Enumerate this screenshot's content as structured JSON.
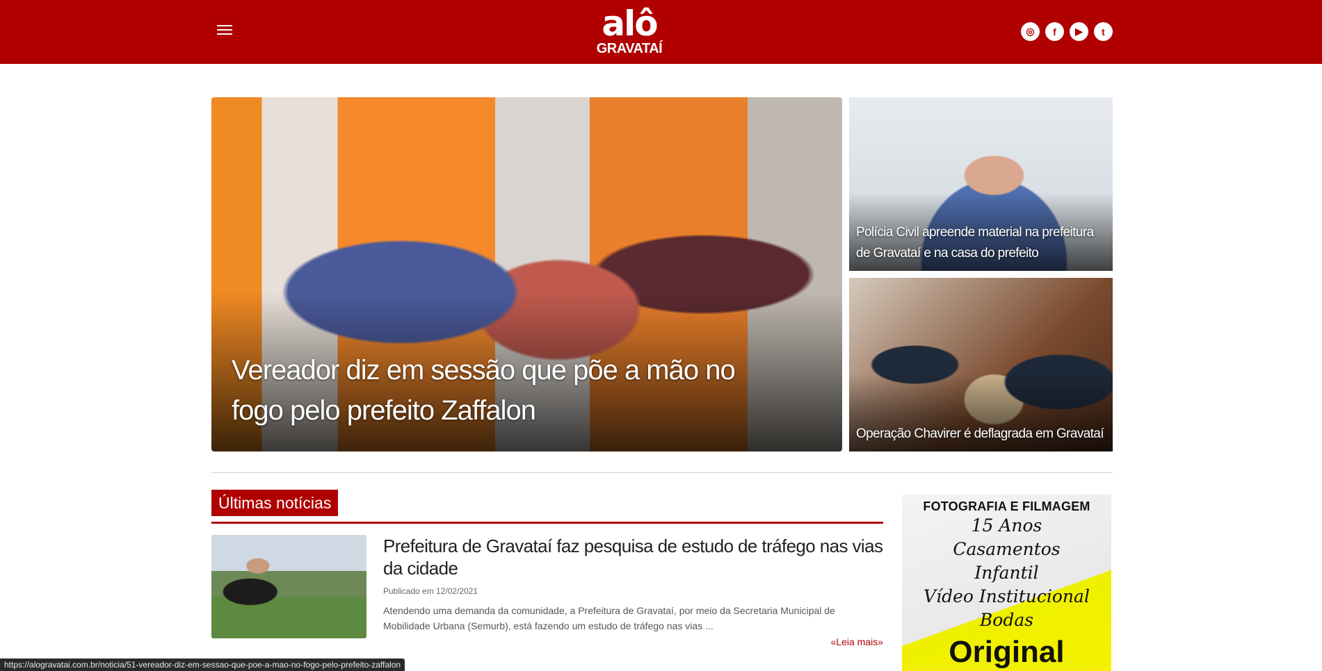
{
  "header": {
    "menu_label": "menu",
    "logo_top": "alô",
    "logo_bottom": "GRAVATAÍ",
    "socials": [
      {
        "icon": "instagram-icon",
        "glyph": "◎"
      },
      {
        "icon": "facebook-icon",
        "glyph": "f"
      },
      {
        "icon": "youtube-icon",
        "glyph": "▶"
      },
      {
        "icon": "twitter-icon",
        "glyph": "t"
      }
    ]
  },
  "featured": {
    "main_title": "Vereador diz em sessão que põe a mão no fogo pelo prefeito Zaffalon",
    "side": [
      {
        "title": "Polícia Civil apreende material na prefeitura de Gravataí e na casa do prefeito"
      },
      {
        "title": "Operação Chavirer é deflagrada em Gravataí"
      }
    ]
  },
  "latest": {
    "heading": "Últimas notícias",
    "items": [
      {
        "title": "Prefeitura de Gravataí faz pesquisa de estudo de tráfego nas vias da cidade",
        "date": "Publicado em 12/02/2021",
        "excerpt": "Atendendo uma demanda da comunidade, a Prefeitura de Gravataí, por meio da Secretaria Municipal de Mobilidade Urbana (Semurb), está fazendo um estudo de tráfego nas vias ...",
        "read_more": "«Leia mais»"
      }
    ]
  },
  "ad": {
    "heading": "FOTOGRAFIA E FILMAGEM",
    "lines": [
      "15 Anos",
      "Casamentos",
      "Infantil",
      "Vídeo Institucional",
      "Bodas"
    ],
    "brand": "Original"
  },
  "status_bar": {
    "url": "https://alogravatai.com.br/noticia/51-vereador-diz-em-sessao-que-poe-a-mao-no-fogo-pelo-prefeito-zaffalon"
  },
  "colors": {
    "brand_red": "#b00000"
  }
}
